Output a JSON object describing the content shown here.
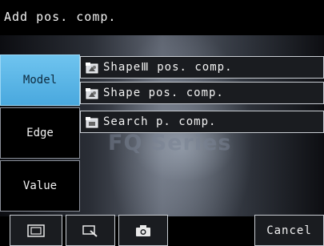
{
  "header": {
    "title": "Add pos. comp."
  },
  "background": {
    "watermark_text": "FQ Series"
  },
  "tabs": [
    {
      "label": "Model",
      "active": true
    },
    {
      "label": "Edge",
      "active": false
    },
    {
      "label": "Value",
      "active": false
    }
  ],
  "items": [
    {
      "label": "ShapeⅢ pos. comp.",
      "icon": "shape-model-icon"
    },
    {
      "label": "Shape pos. comp.",
      "icon": "shape-model-icon"
    },
    {
      "label": "Search p. comp.",
      "icon": "search-model-icon"
    }
  ],
  "bottom": {
    "frame_icon": "frame-icon",
    "zoom_icon": "zoom-icon",
    "camera_icon": "camera-icon",
    "cancel_label": "Cancel"
  },
  "colors": {
    "active_tab": "#5bb6e8",
    "panel": "#1a1c20",
    "border": "#c8ccd2"
  }
}
